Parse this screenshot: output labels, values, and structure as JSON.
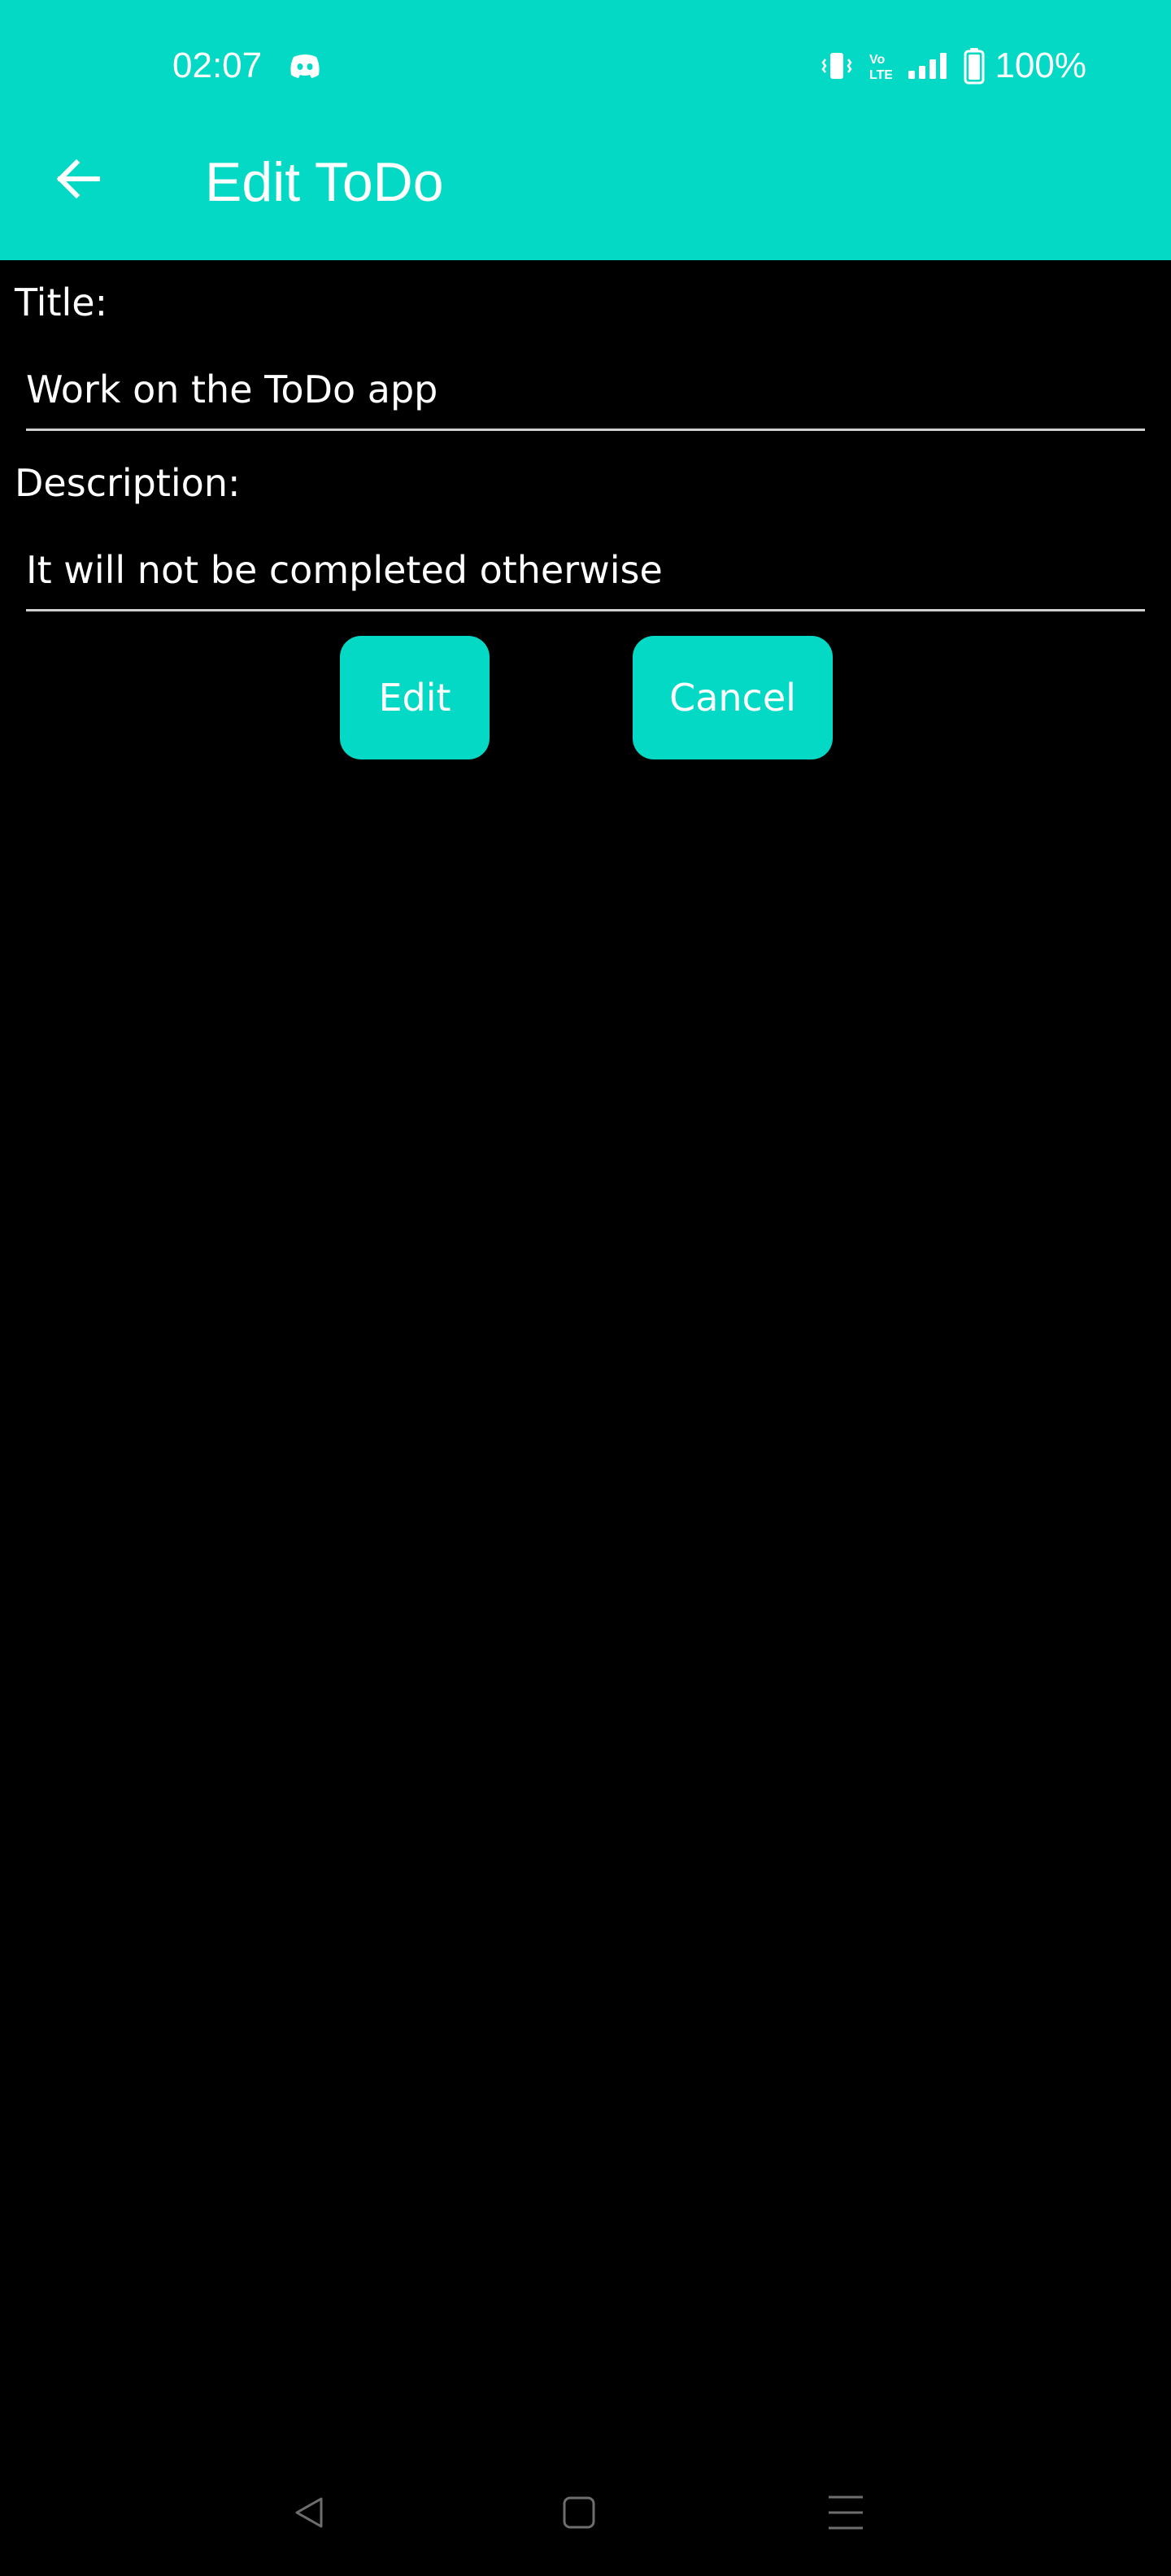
{
  "status_bar": {
    "time": "02:07",
    "battery_percent": "100%",
    "icons": [
      "discord-icon",
      "vibrate-icon",
      "volte-icon",
      "signal-icon",
      "battery-icon"
    ]
  },
  "app_bar": {
    "title": "Edit ToDo",
    "back_icon": "arrow-left-icon"
  },
  "form": {
    "title_label": "Title:",
    "title_value": "Work on the ToDo app",
    "description_label": "Description:",
    "description_value": "It will not be completed otherwise"
  },
  "actions": {
    "edit_label": "Edit",
    "cancel_label": "Cancel"
  },
  "nav_bar": {
    "icons": [
      "back-triangle-icon",
      "home-square-icon",
      "recents-menu-icon"
    ]
  },
  "colors": {
    "accent": "#03D9C5",
    "background": "#000000",
    "text": "#FFFFFF",
    "underline": "#CFCFCF"
  }
}
